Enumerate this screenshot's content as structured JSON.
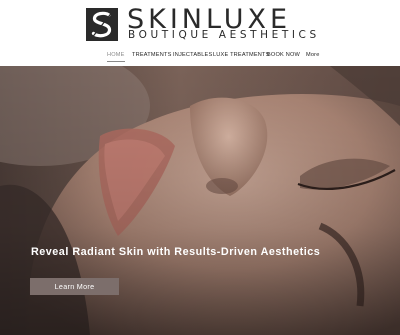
{
  "brand": {
    "name": "SKINLUXE",
    "tagline": "BOUTIQUE AESTHETICS",
    "logo_icon": "s-monogram-logo"
  },
  "nav": {
    "items": [
      {
        "label": "HOME",
        "active": true
      },
      {
        "label": "TREATMENTS",
        "active": false
      },
      {
        "label": "INJECTABLES",
        "active": false
      },
      {
        "label": "LUXE TREATMENTS",
        "active": false
      },
      {
        "label": "BOOK NOW",
        "active": false
      },
      {
        "label": "More",
        "active": false
      }
    ]
  },
  "hero": {
    "headline": "Reveal Radiant Skin with Results-Driven Aesthetics",
    "cta_label": "Learn More",
    "image_subject": "close-up of face with closed eyes"
  },
  "colors": {
    "text_dark": "#2a2a2a",
    "nav_active": "#8a8a8a",
    "cta_bg": "#7c6e6b"
  }
}
